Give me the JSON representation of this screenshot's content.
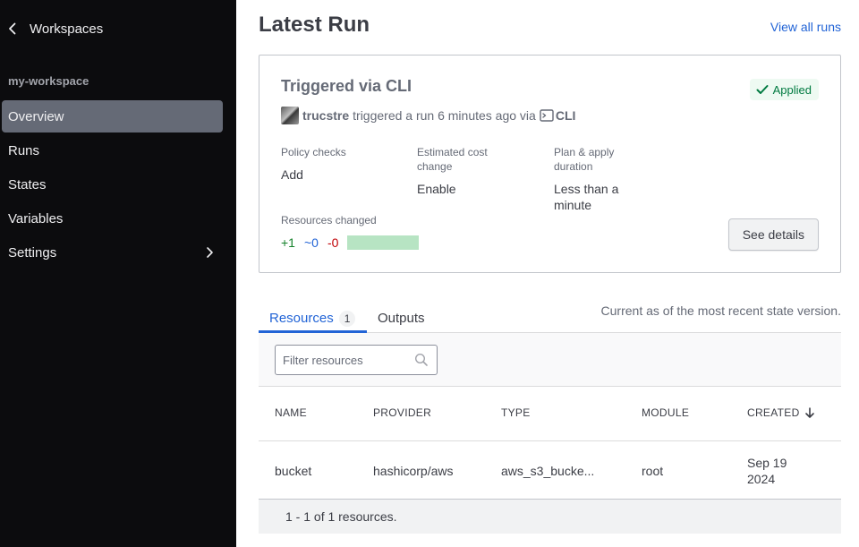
{
  "sidebar": {
    "back_label": "Workspaces",
    "workspace_name": "my-workspace",
    "items": [
      {
        "label": "Overview"
      },
      {
        "label": "Runs"
      },
      {
        "label": "States"
      },
      {
        "label": "Variables"
      },
      {
        "label": "Settings"
      }
    ]
  },
  "main": {
    "title": "Latest Run",
    "view_all_label": "View all runs",
    "run": {
      "title": "Triggered via CLI",
      "status": "Applied",
      "user": "trucstre",
      "trigger_text": "triggered a run 6 minutes ago via",
      "trigger_source": "CLI",
      "policy_checks_label": "Policy checks",
      "policy_checks_value": "Add",
      "estimated_cost_label": "Estimated cost change",
      "estimated_cost_value": "Enable",
      "duration_label": "Plan & apply duration",
      "duration_value": "Less than a minute",
      "resources_changed_label": "Resources changed",
      "added": "+1",
      "changed": "~0",
      "destroyed": "-0",
      "see_details_label": "See details"
    },
    "tabs": [
      {
        "label": "Resources",
        "count": "1"
      },
      {
        "label": "Outputs"
      }
    ],
    "state_note": "Current as of the most recent state version.",
    "filter_placeholder": "Filter resources",
    "table": {
      "headers": [
        "NAME",
        "PROVIDER",
        "TYPE",
        "MODULE",
        "CREATED"
      ],
      "rows": [
        {
          "name": "bucket",
          "provider": "hashicorp/aws",
          "type": "aws_s3_bucke...",
          "module": "root",
          "created": "Sep 19 2024"
        }
      ],
      "footer": "1 - 1 of 1 resources."
    }
  },
  "colors": {
    "sidebar_bg": "#0c0c0e",
    "active_nav": "#656a76",
    "link": "#2264d6",
    "success": "#007a40",
    "add": "#15822b",
    "change": "#2264d6",
    "destroy": "#c00005"
  },
  "icons": [
    "chevron-left-icon",
    "chevron-right-icon",
    "check-icon",
    "terminal-icon",
    "search-icon",
    "arrow-down-icon"
  ]
}
